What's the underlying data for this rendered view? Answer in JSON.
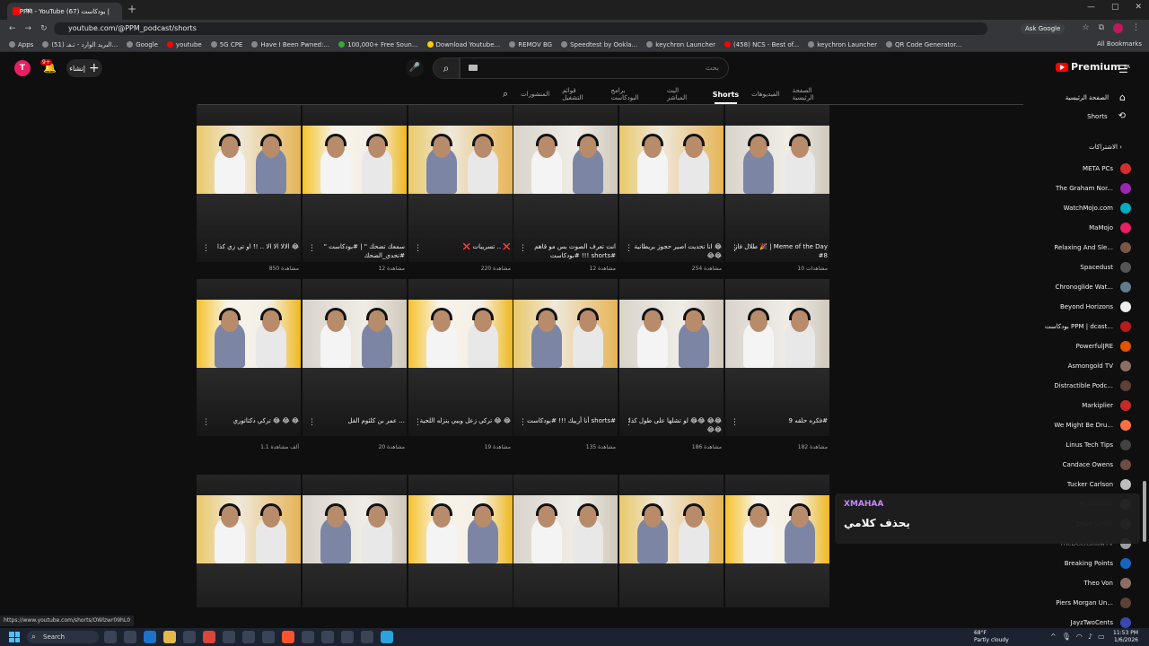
{
  "browser": {
    "tab_title": "PPM - YouTube بودكاست (67) |",
    "url": "youtube.com/@PPM_podcast/shorts",
    "ask_google": "Ask Google",
    "all_bookmarks": "All Bookmarks",
    "bookmarks": [
      "Apps",
      "(51) البريد الوارد - تـفـ...",
      "Google",
      "youtube",
      "5G CPE",
      "Have I Been Pwned:...",
      "100,000+ Free Soun...",
      "Download Youtube...",
      "REMOV BG",
      "Speedtest by Ookla...",
      "keychron Launcher",
      "(458) NCS - Best of...",
      "keychron Launcher",
      "QR Code Generator..."
    ],
    "status_url": "https://www.youtube.com/shorts/OWlzwr09hL0"
  },
  "masthead": {
    "avatar_letter": "T",
    "notif_count": "9+",
    "create_label": "إنشاء",
    "search_placeholder": "بحث",
    "logo_text": "Premium",
    "logo_region": "SA"
  },
  "channel_tabs": [
    "الصفحة الرئيسية",
    "الفيديوهات",
    "Shorts",
    "البث المباشر",
    "برامج البودكاست",
    "قوائم التشغيل",
    "المنشورات"
  ],
  "shorts": [
    {
      "title": "طلال فاز 🎉 | Meme of the Day #8",
      "views": "10 مشاهدات"
    },
    {
      "title": "انا تحديت اصير حجوز بريطانية 😂😂😂",
      "views": "254 مشاهدة"
    },
    {
      "title": "انت تعرف الصوت بس مو قاهم #بودكاست !!! shorts#",
      "views": "12 مشاهدة"
    },
    {
      "title": "❌ تسريبات .. ❌",
      "views": "220 مشاهدة"
    },
    {
      "title": "\" سمعك تضحك \" | #بودكاست #تحدي_الضحك",
      "views": "12 مشاهدة"
    },
    {
      "title": "الالا الا الا .. !! او تي زي كذا 😂",
      "views": "850 مشاهدة"
    },
    {
      "title": "فكره حلقه 9#",
      "views": "182 مشاهدة"
    },
    {
      "title": "لو تشلها على طول كذا 😂😂 😂😂😂😂",
      "views": "186 مشاهدة"
    },
    {
      "title": "أنا أربيك !!! #بودكاست shorts#",
      "views": "135 مشاهدة"
    },
    {
      "title": "تركي زعل وبيي ينزله اللحية 😂 😂",
      "views": "19 مشاهدة"
    },
    {
      "title": "عمر بن كلثوم القل ...",
      "views": "20 مشاهدة"
    },
    {
      "title": "تركي دكتاتوري 😂 😂 😂",
      "views": "1.1 ألف مشاهدة"
    }
  ],
  "sidebar": {
    "home": "الصفحة الرئيسية",
    "shorts": "Shorts",
    "subs_header": "الاشتراكات",
    "channels": [
      "META PCs",
      "The Graham Nor...",
      "WatchMojo.com",
      "MaMojo",
      "Relaxing And Sle...",
      "Spacedust",
      "Chronoglide Wat...",
      "Beyond Horizons",
      "بودكاست PPM | dcast...",
      "PowerfulJRE",
      "Asmongold TV",
      "Distractible Podc...",
      "Markiplier",
      "We Might Be Dru...",
      "Linus Tech Tips",
      "Candace Owens",
      "Tucker Carlson",
      "FLAGRANT",
      "Dave Smith",
      "TheDeenShowTV",
      "Breaking Points",
      "Theo Von",
      "Piers Morgan Un...",
      "JayzTwoCents"
    ]
  },
  "toast": {
    "name": "XMAHAA",
    "message": "يحذف كلامي"
  },
  "taskbar": {
    "search": "Search",
    "weather_temp": "68°F",
    "weather_desc": "Partly cloudy",
    "time": "11:53 PM",
    "date": "1/6/2026"
  }
}
